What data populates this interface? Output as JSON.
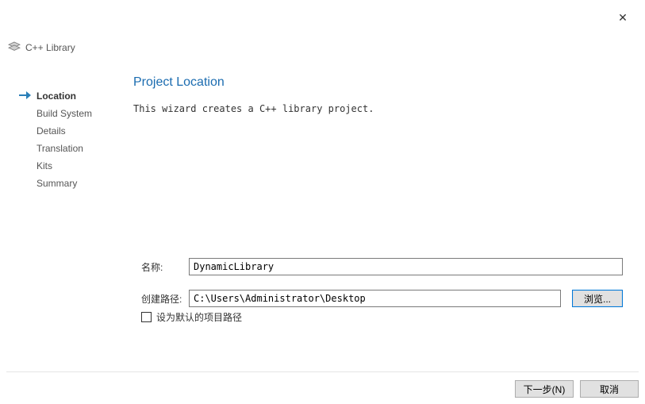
{
  "header": {
    "title": "C++ Library"
  },
  "nav": {
    "items": [
      {
        "label": "Location",
        "active": true
      },
      {
        "label": "Build System",
        "active": false
      },
      {
        "label": "Details",
        "active": false
      },
      {
        "label": "Translation",
        "active": false
      },
      {
        "label": "Kits",
        "active": false
      },
      {
        "label": "Summary",
        "active": false
      }
    ]
  },
  "main": {
    "title": "Project Location",
    "description": "This wizard creates a C++ library project."
  },
  "form": {
    "name_label": "名称:",
    "name_value": "DynamicLibrary",
    "path_label": "创建路径:",
    "path_value": "C:\\Users\\Administrator\\Desktop",
    "browse_label": "浏览...",
    "default_path_label": "设为默认的项目路径",
    "default_path_checked": false
  },
  "footer": {
    "next_label": "下一步(N)",
    "cancel_label": "取消"
  }
}
